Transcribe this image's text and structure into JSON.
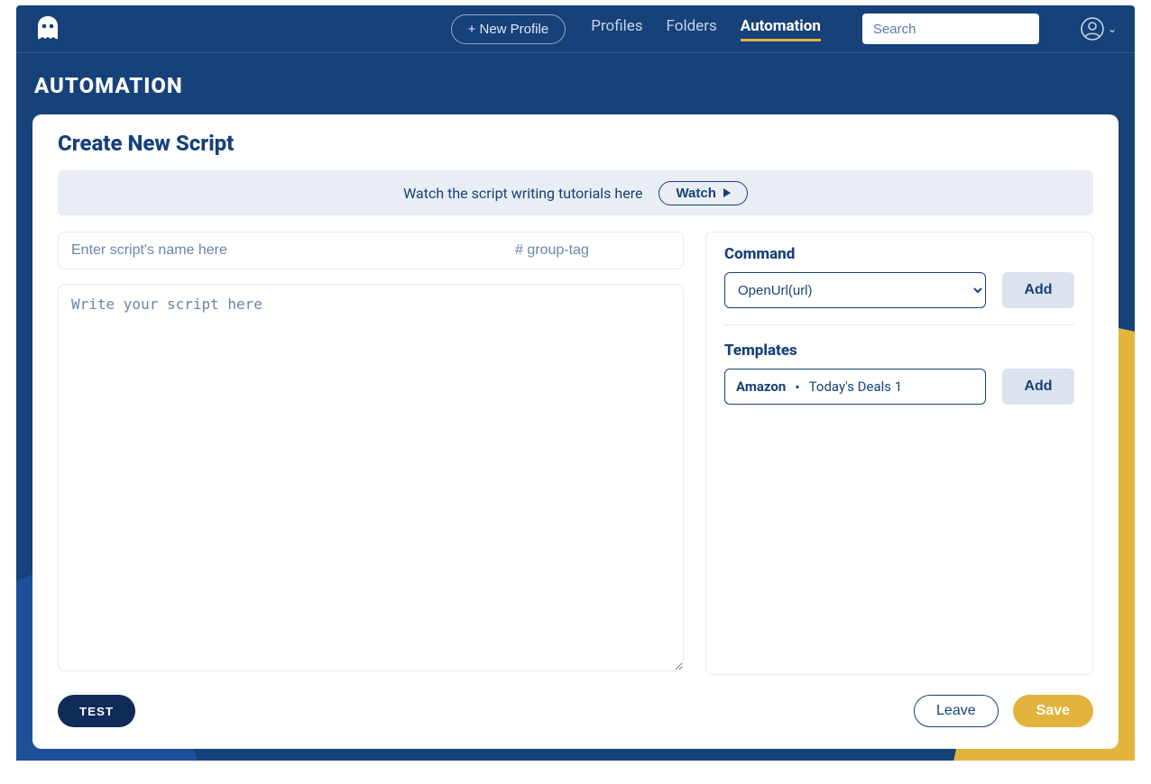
{
  "header": {
    "new_profile": "+ New Profile",
    "nav": {
      "profiles": "Profiles",
      "folders": "Folders",
      "automation": "Automation"
    },
    "search_placeholder": "Search"
  },
  "page": {
    "title": "AUTOMATION"
  },
  "card": {
    "title": "Create New Script",
    "tutorial_text": "Watch the script writing tutorials here",
    "watch_label": "Watch",
    "script_name_placeholder": "Enter script's name here",
    "group_tag_placeholder": "# group-tag",
    "script_body_placeholder": "Write your script here"
  },
  "command": {
    "label": "Command",
    "selected": "OpenUrl(url)",
    "add_label": "Add"
  },
  "templates": {
    "label": "Templates",
    "item": {
      "name": "Amazon",
      "subtitle": "Today's Deals 1"
    },
    "add_label": "Add"
  },
  "footer": {
    "test": "TEST",
    "leave": "Leave",
    "save": "Save"
  },
  "colors": {
    "brand_navy": "#164179",
    "accent_yellow": "#e3b43d",
    "panel_blue": "#1d4f9a",
    "soft_grey": "#e9eef4",
    "btn_grey": "#dbe3ef"
  }
}
